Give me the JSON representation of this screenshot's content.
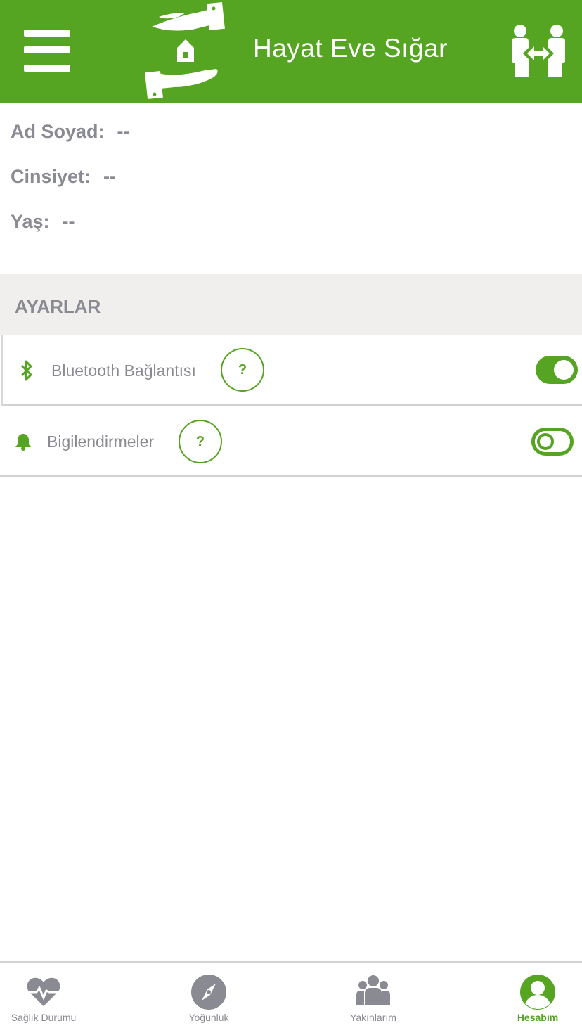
{
  "header": {
    "title": "Hayat Eve Sığar",
    "menu_icon": "hamburger-menu-icon",
    "logo_icon": "hands-house-logo",
    "action_icon": "social-distance-icon",
    "background_color": "#55a422"
  },
  "profile": {
    "name_label": "Ad Soyad:",
    "name_value": "--",
    "gender_label": "Cinsiyet:",
    "gender_value": "--",
    "age_label": "Yaş:",
    "age_value": "--"
  },
  "settings": {
    "section_title": "AYARLAR",
    "items": [
      {
        "label": "Bluetooth Bağlantısı",
        "icon": "bluetooth-icon",
        "help": "?",
        "enabled": true
      },
      {
        "label": "Bigilendirmeler",
        "icon": "bell-icon",
        "help": "?",
        "enabled": false
      }
    ]
  },
  "tabs": [
    {
      "label": "Sağlık Durumu",
      "icon": "heart-pulse-icon",
      "active": false
    },
    {
      "label": "Yoğunluk",
      "icon": "compass-icon",
      "active": false
    },
    {
      "label": "Yakınlarım",
      "icon": "users-icon",
      "active": false
    },
    {
      "label": "Hesabım",
      "icon": "user-circle-icon",
      "active": true
    }
  ],
  "colors": {
    "accent": "#55a422",
    "text_muted": "#8a8a92",
    "section_bg": "#f0efed"
  }
}
